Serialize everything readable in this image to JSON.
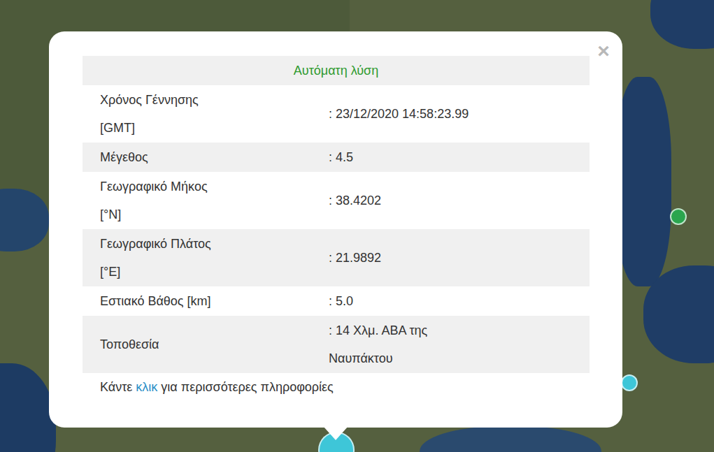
{
  "map": {
    "pins": [
      {
        "color": "#2aa54e"
      },
      {
        "color": "#3ec6d8"
      },
      {
        "color": "#3ec6d8"
      }
    ]
  },
  "popup": {
    "close": "×",
    "header": "Αυτόματη λύση",
    "rows": [
      {
        "label_lines": [
          "Χρόνος Γέννησης",
          "[GMT]"
        ],
        "value_lines": [
          ": 23/12/2020 14:58:23.99"
        ]
      },
      {
        "label_lines": [
          "Μέγεθος"
        ],
        "value_lines": [
          ": 4.5"
        ]
      },
      {
        "label_lines": [
          "Γεωγραφικό Μήκος",
          "[°N]"
        ],
        "value_lines": [
          ": 38.4202"
        ]
      },
      {
        "label_lines": [
          "Γεωγραφικό Πλάτος",
          "[°E]"
        ],
        "value_lines": [
          ": 21.9892"
        ]
      },
      {
        "label_lines": [
          "Εστιακό Βάθος [km]"
        ],
        "value_lines": [
          ": 5.0"
        ]
      },
      {
        "label_lines": [
          "Τοποθεσία"
        ],
        "value_lines": [
          ": 14 Χλμ. ΑΒΑ της",
          "Ναυπάκτου"
        ]
      }
    ],
    "footer": {
      "before": "Κάντε",
      "link": "κλικ",
      "after": "για περισσότερες πληροφορίες"
    }
  }
}
